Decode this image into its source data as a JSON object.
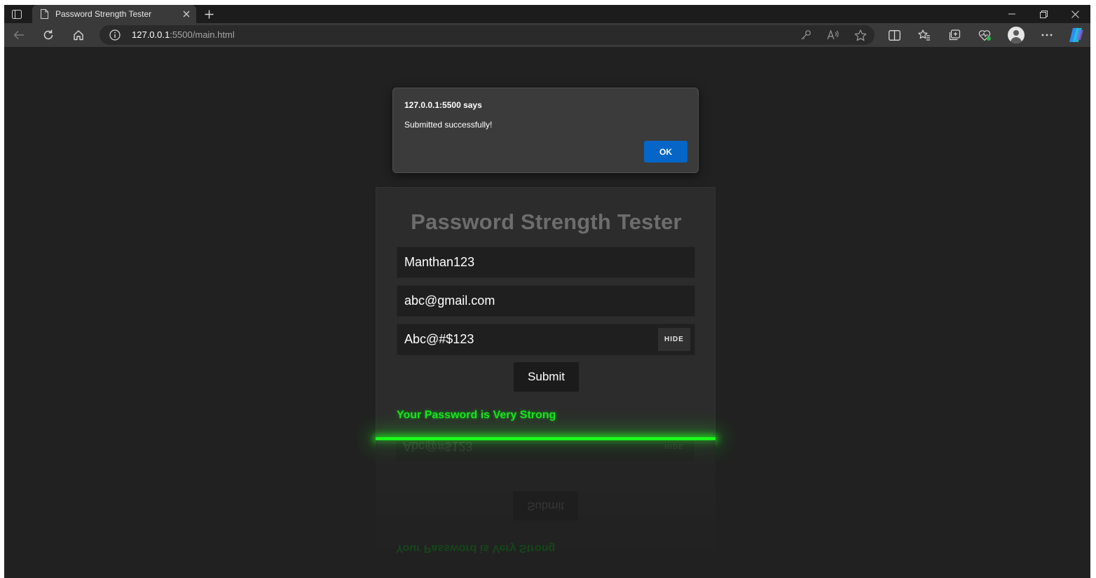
{
  "browser": {
    "tab": {
      "title": "Password Strength Tester",
      "icon": "page-icon"
    },
    "address": {
      "host": "127.0.0.1",
      "rest": ":5500/main.html"
    },
    "toolbar_icons": [
      "back-icon",
      "refresh-icon",
      "home-icon",
      "info-icon",
      "key-icon",
      "read-aloud-icon",
      "favorite-star-icon",
      "split-screen-icon",
      "favorites-icon",
      "collections-icon",
      "browser-essentials-icon",
      "profile-avatar",
      "more-icon",
      "copilot-icon"
    ]
  },
  "page": {
    "card_title": "Password Strength Tester",
    "username_value": "Manthan123",
    "email_value": "abc@gmail.com",
    "password_value": "Abc@#$123",
    "hide_label": "HIDE",
    "submit_label": "Submit",
    "strength_message": "Your Password is Very Strong",
    "colors": {
      "strength_text": "#17e51d",
      "glow_bar": "#1aff1a",
      "card_bg": "#2c2c2c",
      "page_bg": "#212121"
    }
  },
  "dialog": {
    "title": "127.0.0.1:5500 says",
    "message": "Submitted successfully!",
    "ok_label": "OK",
    "ok_color": "#0566c8"
  }
}
